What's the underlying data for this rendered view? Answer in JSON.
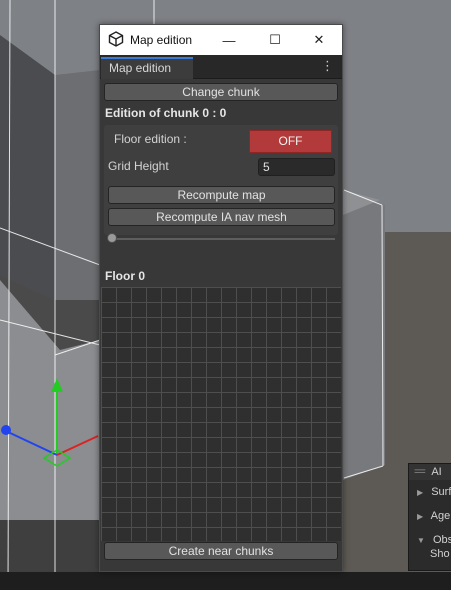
{
  "window": {
    "title": "Map edition",
    "tab_label": "Map edition",
    "minimize_glyph": "—",
    "maximize_glyph": "☐",
    "close_glyph": "✕",
    "menu_glyph": "⋮"
  },
  "editor": {
    "change_chunk_label": "Change chunk",
    "chunk_heading": "Edition of chunk 0 : 0",
    "floor_edition_label": "Floor edition :",
    "floor_edition_toggle": "OFF",
    "grid_height_label": "Grid Height",
    "grid_height_value": "5",
    "recompute_map_label": "Recompute map",
    "recompute_ia_label": "Recompute IA nav mesh",
    "slider_value": 0,
    "floor_heading": "Floor 0",
    "create_near_label": "Create near chunks"
  },
  "ai_panel": {
    "title": "AI",
    "rows": [
      "Surf",
      "Age",
      "Obs"
    ],
    "sub_row": "Sho"
  },
  "colors": {
    "toggle_off": "#b23a3a",
    "tab_accent": "#3a79d8",
    "gizmo_green": "#22cc22",
    "gizmo_red": "#dd2222",
    "gizmo_blue": "#2244ee"
  }
}
